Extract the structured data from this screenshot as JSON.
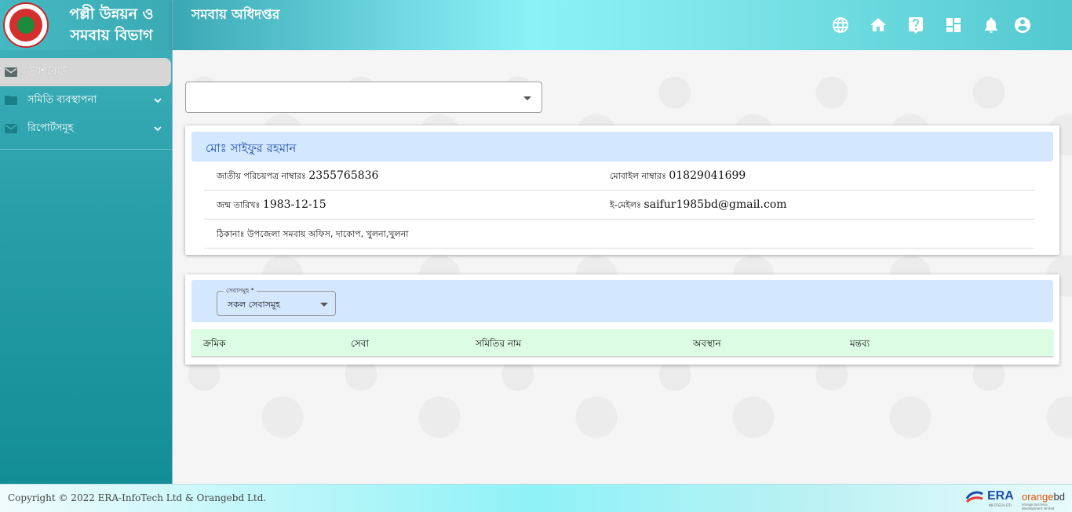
{
  "brand": {
    "line1": "পল্লী উন্নয়ন ও",
    "line2": "সমবায় বিভাগ"
  },
  "header": {
    "title": "সমবায় অধিদপ্তর",
    "icons": [
      "globe-icon",
      "home-icon",
      "help-icon",
      "dashboard-icon",
      "bell-icon",
      "account-icon"
    ]
  },
  "sidebar": {
    "items": [
      {
        "label": "ড্যাশবোর্ড",
        "active": true
      },
      {
        "label": "সমিতি ব্যবস্থাপনা",
        "expandable": true
      },
      {
        "label": "রিপোর্টসমূহ",
        "expandable": true
      }
    ]
  },
  "top_select": {
    "value": ""
  },
  "profile": {
    "name": "মোঃ সাইফুর রহমান",
    "nid_label": "জাতীয় পরিচয়পত্র নাম্বারঃ",
    "nid_value": "2355765836",
    "mobile_label": "মোবাইল নাম্বারঃ",
    "mobile_value": "01829041699",
    "dob_label": "জন্ম তারিখঃ",
    "dob_value": "1983-12-15",
    "email_label": "ই-মেইলঃ",
    "email_value": "saifur1985bd@gmail.com",
    "address_label": "ঠিকানাঃ",
    "address_value": "উপজেলা সমবায় অফিস, দাকোপ, খুলনা,খুলনা"
  },
  "services": {
    "filter_label": "সেবাসমূহ *",
    "filter_value": "সকল সেবাসমূহ",
    "columns": [
      "ক্রমিক",
      "সেবা",
      "সমিতির নাম",
      "অবস্থান",
      "মন্তব্য"
    ]
  },
  "footer": {
    "copyright": "Copyright © 2022 ERA-InfoTech Ltd & Orangebd Ltd.",
    "era_logo_text": "ERA",
    "era_logo_sub": "INFOTECH LTD",
    "orange_logo_text_colored": "orange",
    "orange_logo_text_plain": "bd",
    "orange_logo_sub": "orange business development limited"
  },
  "colors": {
    "sidebar": "#2aa0aa",
    "header_accent": "#8af3f8",
    "name_bar": "#d3e7fe",
    "name_text": "#1e4fa8",
    "table_head": "#dcfce4"
  }
}
